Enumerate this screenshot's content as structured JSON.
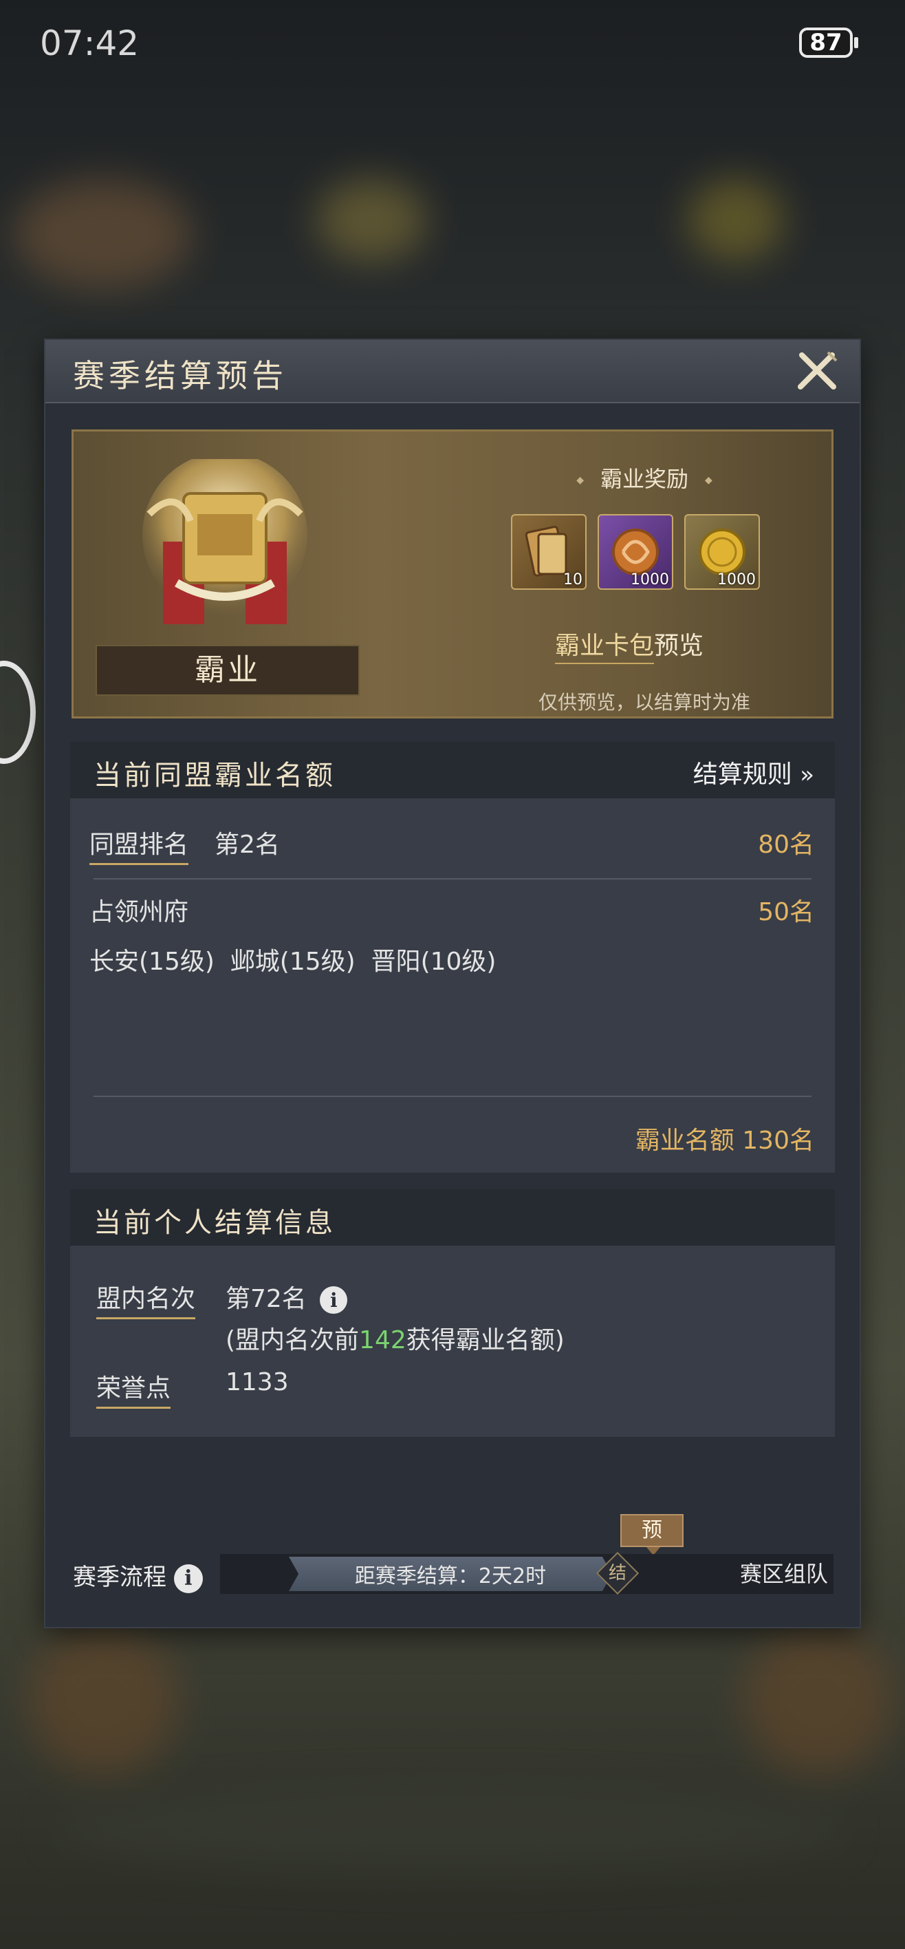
{
  "status_bar": {
    "time": "07:42",
    "battery": "87"
  },
  "dialog": {
    "title": "赛季结算预告",
    "banner": {
      "emblem_label": "霸业",
      "reward_title": "霸业奖励",
      "items": [
        {
          "name": "token-card-icon",
          "count": "10",
          "color": "#7a5a2e"
        },
        {
          "name": "jade-coin-icon",
          "count": "1000",
          "color": "#6a3f8a"
        },
        {
          "name": "gold-coin-icon",
          "count": "1000",
          "color": "#6a5a3a"
        }
      ],
      "card_pack_link": "霸业卡包",
      "card_pack_suffix": "预览",
      "note": "仅供预览，以结算时为准"
    },
    "alliance": {
      "title": "当前同盟霸业名额",
      "rules_link": "结算规则",
      "rank_label": "同盟排名",
      "rank_value": "第2名",
      "rank_quota": "80名",
      "occupy_label": "占领州府",
      "occupy_quota": "50名",
      "cities": "长安(15级)  邺城(15级)  晋阳(10级)",
      "total_label": "霸业名额 130名"
    },
    "personal": {
      "title": "当前个人结算信息",
      "rank_label": "盟内名次",
      "rank_value": "第72名",
      "note_prefix": "(盟内名次前",
      "note_number": "142",
      "note_suffix": "获得霸业名额)",
      "honor_label": "荣誉点",
      "honor_value": "1133"
    },
    "season_flow": {
      "label": "赛季流程",
      "countdown": "距赛季结算：2天2时",
      "node_label": "结",
      "pre_tag": "预",
      "end_label": "赛区组队"
    }
  }
}
